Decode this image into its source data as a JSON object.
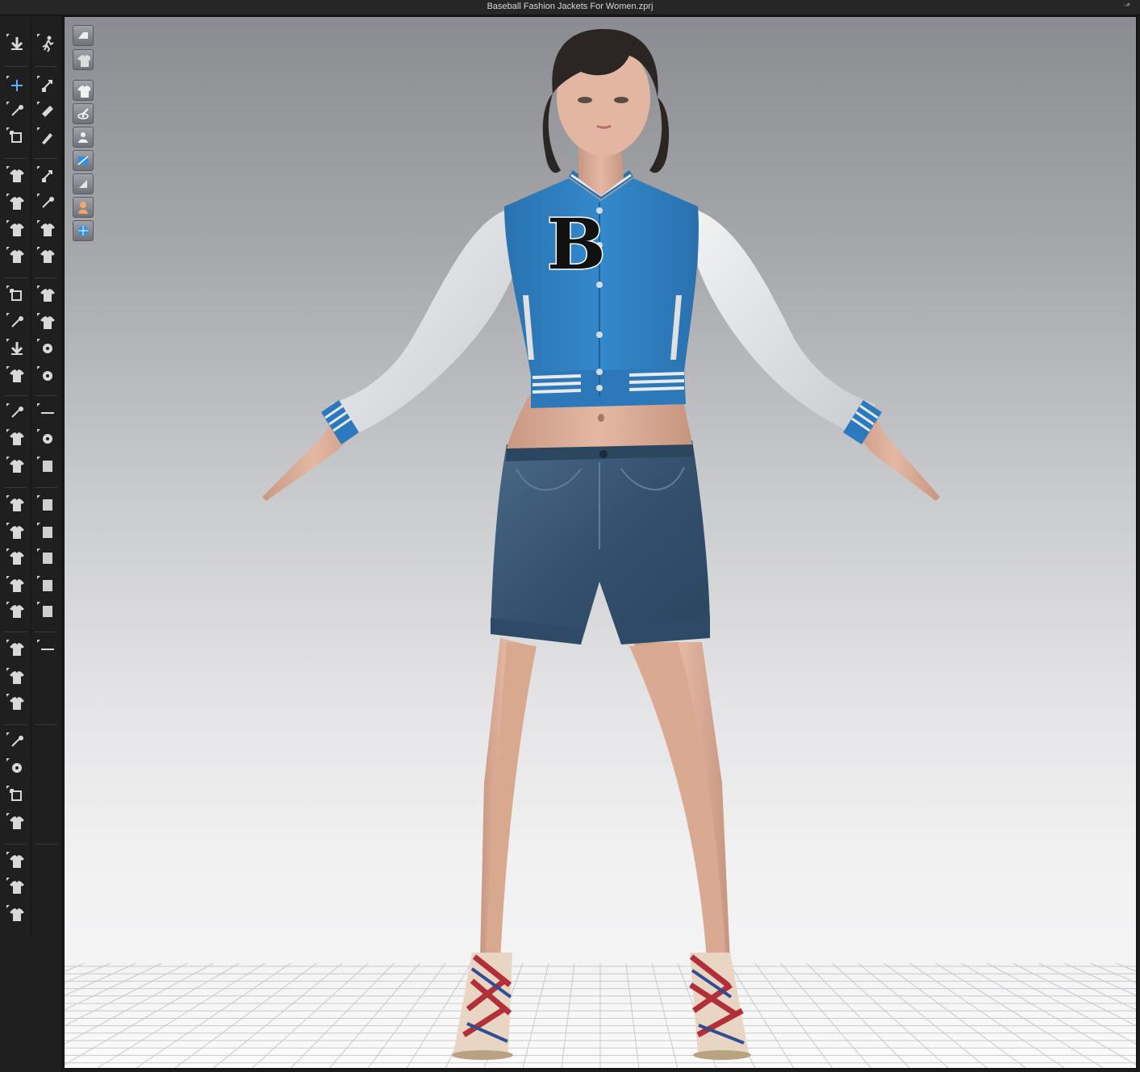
{
  "window": {
    "title": "Baseball Fashion Jackets For Women.zprj"
  },
  "toolbar": {
    "tools": [
      {
        "name": "simulation-icon"
      },
      {
        "name": "animation-run-icon"
      },
      {
        "name": "select-move-icon"
      },
      {
        "name": "select-mesh-icon"
      },
      {
        "name": "edit-pattern-icon"
      },
      {
        "name": "edit-mesh-icon"
      },
      {
        "name": "transform-pattern-icon"
      },
      {
        "name": "pin-icon"
      },
      {
        "name": "fold-arrangement-icon"
      },
      {
        "name": "tack-icon"
      },
      {
        "name": "garment-icon"
      },
      {
        "name": "avatar-measure-icon"
      },
      {
        "name": "shirt-edit-icon"
      },
      {
        "name": "flip-icon"
      },
      {
        "name": "texture-edit-icon"
      },
      {
        "name": "graphic-icon"
      },
      {
        "name": "sew-icon"
      },
      {
        "name": "button-icon"
      },
      {
        "name": "zipper-icon"
      },
      {
        "name": "topstitch-icon"
      },
      {
        "name": "line-icon"
      },
      {
        "name": "fold-icon"
      },
      {
        "name": "lock-icon"
      },
      {
        "name": "trim-icon"
      },
      {
        "name": "shirt-layer-icon"
      },
      {
        "name": "puckering-icon"
      },
      {
        "name": "fitting-icon"
      },
      {
        "name": "cloth-icon"
      },
      {
        "name": "shirt-front-icon"
      },
      {
        "name": "block-icon"
      },
      {
        "name": "vest-icon"
      },
      {
        "name": "block-small-icon"
      },
      {
        "name": "avatar-icon"
      },
      {
        "name": "square-icon"
      },
      {
        "name": "strengthen-up-icon"
      },
      {
        "name": "strengthen-down-icon"
      },
      {
        "name": "layer-icon"
      },
      {
        "name": "shrink-icon"
      },
      {
        "name": "measure-arc-icon"
      },
      {
        "name": "measure-circumference-icon"
      },
      {
        "name": "ruler-icon"
      },
      {
        "name": "fit-map-icon"
      },
      {
        "name": "tshirt-icon"
      },
      {
        "name": "shirt-icon"
      },
      {
        "name": "brain-icon"
      }
    ]
  },
  "viewport": {
    "view_tools": [
      {
        "name": "view-texture-icon"
      },
      {
        "name": "view-shirt-icon"
      },
      {
        "name": "view-garment-icon"
      },
      {
        "name": "view-eye-icon"
      },
      {
        "name": "view-avatar-visibility-icon"
      },
      {
        "name": "view-fabric-icon"
      },
      {
        "name": "view-solid-icon"
      },
      {
        "name": "view-skin-icon"
      },
      {
        "name": "view-globe-icon"
      }
    ],
    "background_top": "#8b8c91",
    "background_bottom": "#f6f6f7",
    "jacket_body_color": "#2f7fc1",
    "jacket_sleeve_color": "#e6e7e9",
    "jacket_letter": "B",
    "shorts_color": "#3a5775"
  }
}
